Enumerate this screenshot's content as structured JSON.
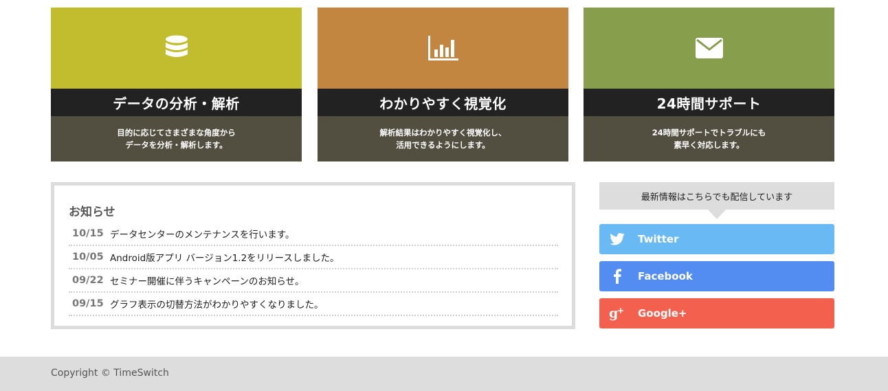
{
  "features": [
    {
      "icon": "database-icon",
      "color": "#c2bd2f",
      "title": "データの分析・解析",
      "desc_line1": "目的に応じてさまざまな角度から",
      "desc_line2": "データを分析・解析します。"
    },
    {
      "icon": "bar-chart-icon",
      "color": "#c38641",
      "title": "わかりやすく視覚化",
      "desc_line1": "解析結果はわかりやすく視覚化し、",
      "desc_line2": "活用できるようにします。"
    },
    {
      "icon": "envelope-icon",
      "color": "#879e4c",
      "title": "24時間サポート",
      "desc_line1": "24時間サポートでトラブルにも",
      "desc_line2": "素早く対応します。"
    }
  ],
  "news": {
    "title": "お知らせ",
    "items": [
      {
        "date": "10/15",
        "text": "データセンターのメンテナンスを行います。"
      },
      {
        "date": "10/05",
        "text": "Android版アプリ バージョン1.2をリリースしました。"
      },
      {
        "date": "09/22",
        "text": "セミナー開催に伴うキャンペーンのお知らせ。"
      },
      {
        "date": "09/15",
        "text": "グラフ表示の切替方法がわかりやすくなりました。"
      }
    ]
  },
  "social": {
    "heading": "最新情報はこちらでも配信しています",
    "buttons": [
      {
        "label": "Twitter",
        "icon": "twitter-icon",
        "color": "#68b9f4"
      },
      {
        "label": "Facebook",
        "icon": "facebook-icon",
        "color": "#548df1"
      },
      {
        "label": "Google+",
        "icon": "google-plus-icon",
        "color": "#f4604e"
      }
    ]
  },
  "footer": {
    "copyright": "Copyright © TimeSwitch"
  }
}
